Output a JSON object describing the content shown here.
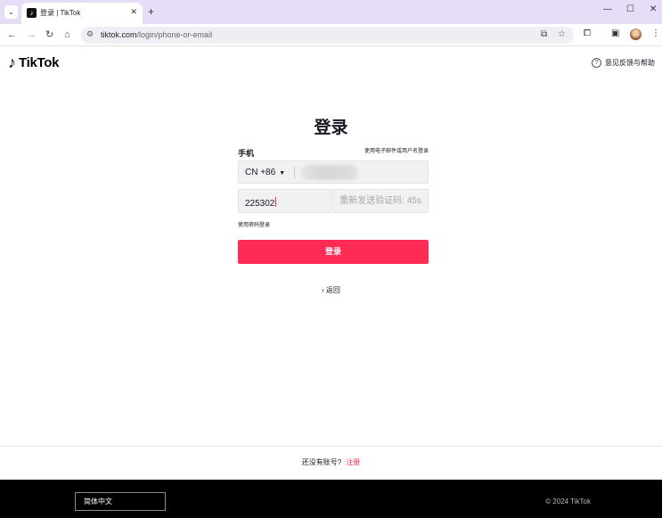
{
  "browser": {
    "tab_title": "登录 | TikTok",
    "tab_favicon": "tiktok-favicon",
    "url_host": "tiktok.com",
    "url_path": "/login/phone-or-email",
    "icons": [
      "chevron-down-icon",
      "close-icon",
      "plus-icon",
      "minimize-icon",
      "maximize-icon",
      "back-icon",
      "forward-icon",
      "reload-icon",
      "home-icon",
      "site-info-icon",
      "install-icon",
      "star-icon",
      "extensions-icon",
      "side-panel-icon",
      "profile-avatar",
      "more-icon"
    ]
  },
  "header": {
    "logo_text": "TikTok",
    "feedback_label": "意见反馈与帮助"
  },
  "login": {
    "title": "登录",
    "phone_label": "手机",
    "alt_login_link": "使用电子邮件或用户名登录",
    "country_code": "CN +86",
    "phone_value": "",
    "code_value": "225302",
    "resend_label": "重新发送验证码: 45s",
    "password_login_link": "使用密码登录",
    "submit_label": "登录",
    "back_label": "返回"
  },
  "signup": {
    "prompt": "还没有账号?",
    "link": "注册"
  },
  "footer": {
    "language": "简体中文",
    "copyright": "© 2024 TikTok"
  },
  "colors": {
    "brand_red": "#fe2c55",
    "tabbar_bg": "#e7ddf7",
    "footer_bg": "#000000",
    "input_bg": "#f1f1f2"
  }
}
